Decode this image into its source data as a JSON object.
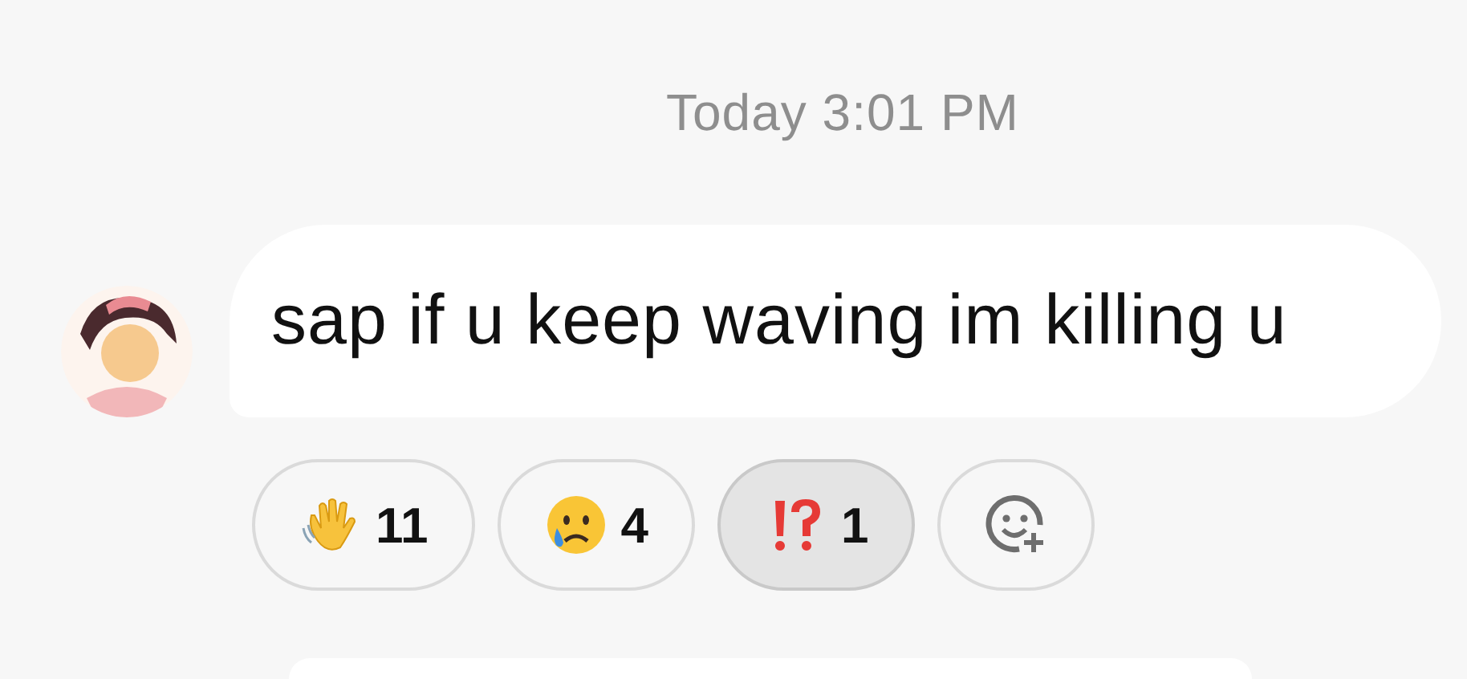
{
  "timestamp": "Today 3:01 PM",
  "message": {
    "text": "sap if u keep waving im killing u"
  },
  "reactions": [
    {
      "kind": "wave",
      "count": "11",
      "selected": false
    },
    {
      "kind": "cry",
      "count": "4",
      "selected": false
    },
    {
      "kind": "interrobang",
      "count": "1",
      "selected": true
    },
    {
      "kind": "add",
      "selected": false
    }
  ]
}
